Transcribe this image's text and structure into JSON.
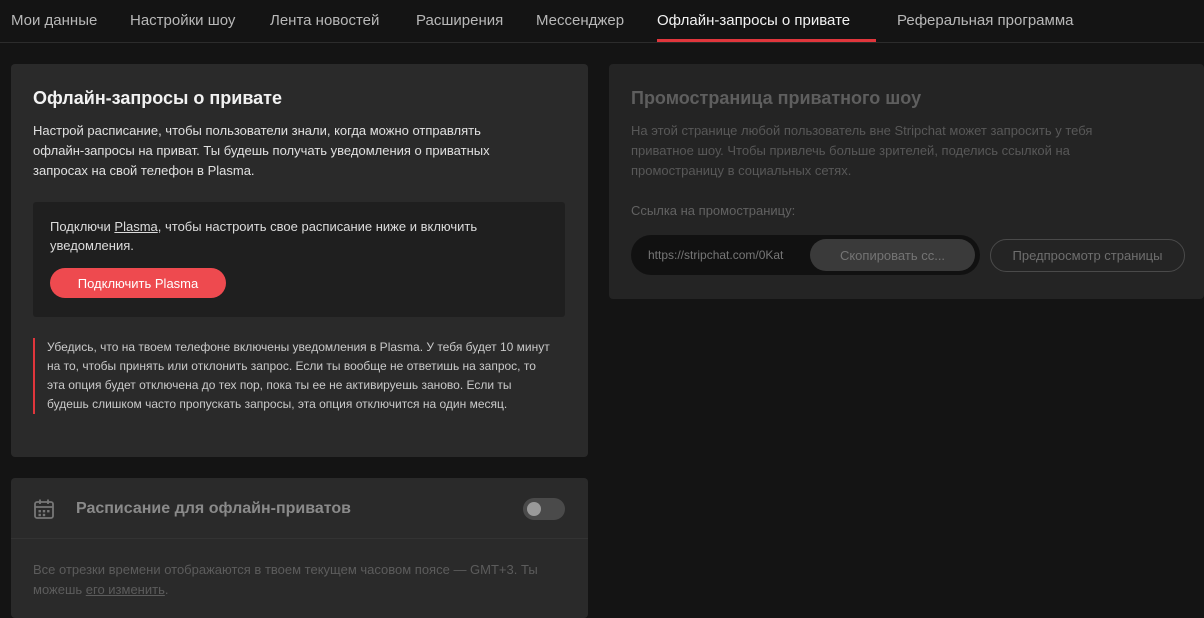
{
  "tabs": [
    {
      "label": "Мои данные"
    },
    {
      "label": "Настройки шоу"
    },
    {
      "label": "Лента новостей"
    },
    {
      "label": "Расширения"
    },
    {
      "label": "Мессенджер"
    },
    {
      "label": "Офлайн-запросы о привате"
    },
    {
      "label": "Реферальная программа"
    }
  ],
  "active_tab": "Офлайн-запросы о привате",
  "offline": {
    "title": "Офлайн-запросы о привате",
    "description": "Настрой расписание, чтобы пользователи знали, когда можно отправлять офлайн-запросы на приват. Ты будешь получать уведомления о приватных запросах на свой телефон в Plasma.",
    "connect_prefix": "Подключи ",
    "connect_link": "Plasma",
    "connect_suffix": ", чтобы настроить свое расписание ниже и включить уведомления.",
    "connect_button": "Подключить Plasma",
    "notice": "Убедись, что на твоем телефоне включены уведомления в Plasma. У тебя будет 10 минут на то, чтобы принять или отклонить запрос. Если ты вообще не ответишь на запрос, то эта опция будет отключена до тех пор, пока ты ее не активируешь заново. Если ты будешь слишком часто пропускать запросы, эта опция отключится на один месяц."
  },
  "schedule": {
    "title": "Расписание для офлайн-приватов",
    "toggle_on": false,
    "timezone_text": "Все отрезки времени отображаются в твоем текущем часовом поясе — GMT+3. Ты можешь ",
    "timezone_link": "его изменить",
    "timezone_suffix": "."
  },
  "promo": {
    "title": "Промостраница приватного шоу",
    "description": "На этой странице любой пользователь вне Stripchat может запросить у тебя приватное шоу. Чтобы привлечь больше зрителей, поделись ссылкой на промостраницу в социальных сетях.",
    "link_label": "Ссылка на промостраницу:",
    "url": "https://stripchat.com/0Kat",
    "copy_button": "Скопировать сс...",
    "preview_button": "Предпросмотр страницы"
  },
  "colors": {
    "accent": "#e0363c",
    "button": "#ee4a4f",
    "background": "#141414",
    "card": "#2a2a2a"
  },
  "icons": {
    "schedule": "calendar-icon"
  }
}
